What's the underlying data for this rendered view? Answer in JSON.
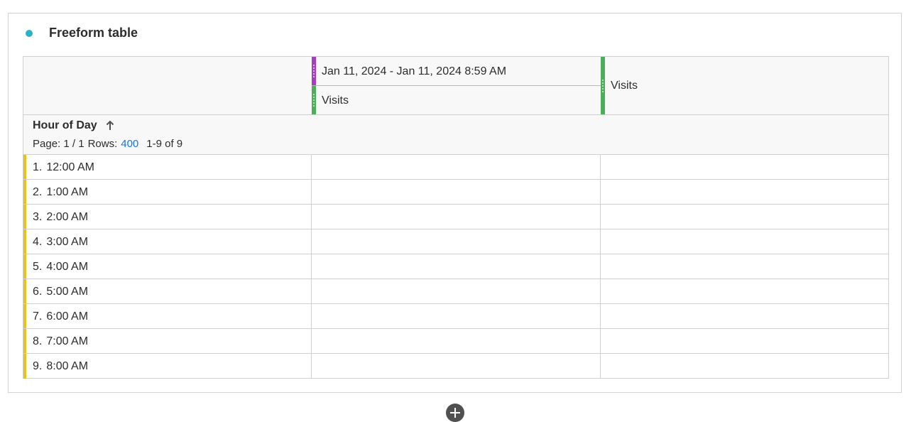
{
  "panel": {
    "title": "Freeform table",
    "dot_color": "#2ab2c4",
    "icon": "status-dot-icon"
  },
  "table": {
    "columns": [
      {
        "segment_label": "Jan 11, 2024 - Jan 11, 2024 8:59 AM",
        "segment_color": "#a53fbf",
        "metric_label": "Visits",
        "metric_color": "#4cae5b"
      },
      {
        "metric_label": "Visits",
        "metric_color": "#4cae5b"
      }
    ],
    "dimension": {
      "title": "Hour of Day",
      "sort_icon": "sort-ascending-arrow-icon"
    },
    "pager": {
      "page_label": "Page: 1 / 1",
      "rows_label": "Rows:",
      "rows_value": "400",
      "range_label": "1-9 of 9"
    },
    "row_accent_color": "#e8c21c",
    "rows": [
      {
        "num": "1.",
        "label": "12:00 AM",
        "v1": "",
        "v2": ""
      },
      {
        "num": "2.",
        "label": "1:00 AM",
        "v1": "",
        "v2": ""
      },
      {
        "num": "3.",
        "label": "2:00 AM",
        "v1": "",
        "v2": ""
      },
      {
        "num": "4.",
        "label": "3:00 AM",
        "v1": "",
        "v2": ""
      },
      {
        "num": "5.",
        "label": "4:00 AM",
        "v1": "",
        "v2": ""
      },
      {
        "num": "6.",
        "label": "5:00 AM",
        "v1": "",
        "v2": ""
      },
      {
        "num": "7.",
        "label": "6:00 AM",
        "v1": "",
        "v2": ""
      },
      {
        "num": "8.",
        "label": "7:00 AM",
        "v1": "",
        "v2": ""
      },
      {
        "num": "9.",
        "label": "8:00 AM",
        "v1": "",
        "v2": ""
      }
    ]
  },
  "footer": {
    "add_icon": "add-visualization-icon"
  }
}
